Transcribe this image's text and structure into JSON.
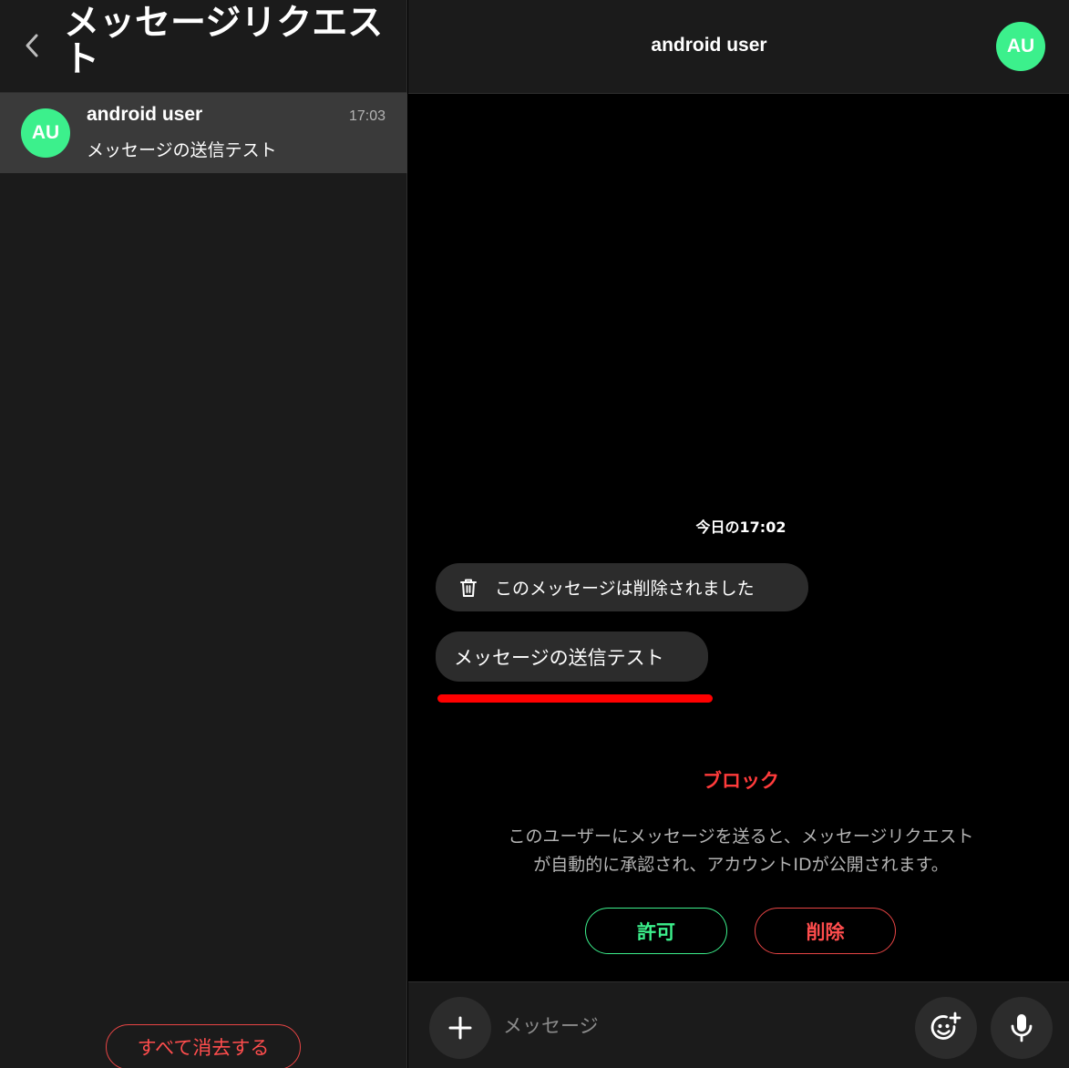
{
  "left_pane": {
    "title": "メッセージリクエスト",
    "conversations": [
      {
        "avatar_initials": "AU",
        "name": "android user",
        "time": "17:03",
        "preview": "メッセージの送信テスト"
      }
    ],
    "clear_all_label": "すべて消去する"
  },
  "chat": {
    "title": "android user",
    "avatar_initials": "AU",
    "date_label": "今日の17:02",
    "messages": [
      {
        "type": "deleted",
        "text": "このメッセージは削除されました",
        "icon": "trash-icon"
      },
      {
        "type": "text",
        "text": "メッセージの送信テスト"
      }
    ],
    "block_label": "ブロック",
    "notice": "このユーザーにメッセージを送ると、メッセージリクエストが自動的に承認され、アカウントIDが公開されます。",
    "notice_line1": "このユーザーにメッセージを送ると、メッセージリクエスト",
    "notice_line2": "が自動的に承認され、アカウントIDが公開されます。",
    "allow_label": "許可",
    "delete_label": "削除"
  },
  "composer": {
    "placeholder": "メッセージ",
    "icons": [
      "plus-icon",
      "emoji-add-icon",
      "microphone-icon"
    ]
  },
  "colors": {
    "accent_green": "#3cf08c",
    "danger_red": "#ff4d4d",
    "highlight_underline": "#ff0000",
    "panel_bg": "#1b1b1b",
    "bubble_bg": "#2c2c2c"
  }
}
